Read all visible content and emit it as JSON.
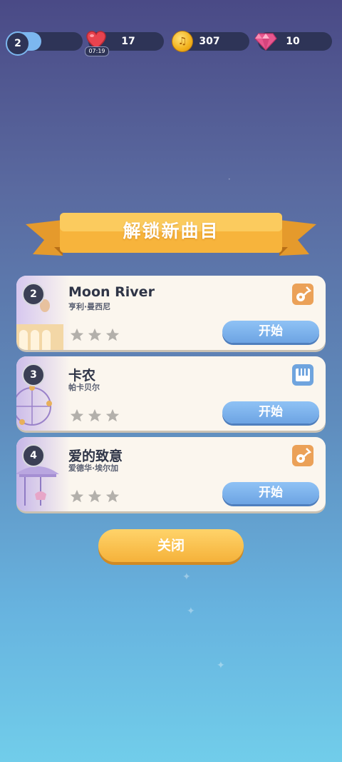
{
  "hud": {
    "level": "2",
    "level_progress": 0.38,
    "lives": "17",
    "life_timer": "07:19",
    "coins": "307",
    "gems": "10"
  },
  "popup": {
    "title": "解锁新曲目",
    "songs": [
      {
        "index": "2",
        "title": "Moon River",
        "artist": "亨利·曼西尼",
        "instrument": "guitar-icon",
        "stars_earned": 0,
        "start_label": "开始"
      },
      {
        "index": "3",
        "title": "卡农",
        "artist": "帕卡贝尔",
        "instrument": "piano-icon",
        "stars_earned": 0,
        "start_label": "开始"
      },
      {
        "index": "4",
        "title": "爱的致意",
        "artist": "爱德华·埃尔加",
        "instrument": "guitar-icon",
        "stars_earned": 0,
        "start_label": "开始"
      }
    ],
    "close_label": "关闭"
  },
  "colors": {
    "ribbon": "#f7b43c",
    "start_button": "#7cb2ec",
    "close_button": "#f8c04e",
    "card_bg": "#fbf6ee"
  }
}
